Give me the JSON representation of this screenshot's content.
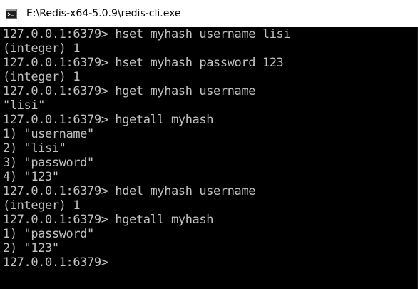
{
  "window": {
    "title": "E:\\Redis-x64-5.0.9\\redis-cli.exe",
    "icon": "terminal-app-icon"
  },
  "console": {
    "text_color": "#c0c0c0",
    "background_color": "#000000",
    "lines": [
      "127.0.0.1:6379> hset myhash username lisi",
      "(integer) 1",
      "127.0.0.1:6379> hset myhash password 123",
      "(integer) 1",
      "127.0.0.1:6379> hget myhash username",
      "\"lisi\"",
      "127.0.0.1:6379> hgetall myhash",
      "1) \"username\"",
      "2) \"lisi\"",
      "3) \"password\"",
      "4) \"123\"",
      "127.0.0.1:6379> hdel myhash username",
      "(integer) 1",
      "127.0.0.1:6379> hgetall myhash",
      "1) \"password\"",
      "2) \"123\"",
      "127.0.0.1:6379>"
    ]
  }
}
